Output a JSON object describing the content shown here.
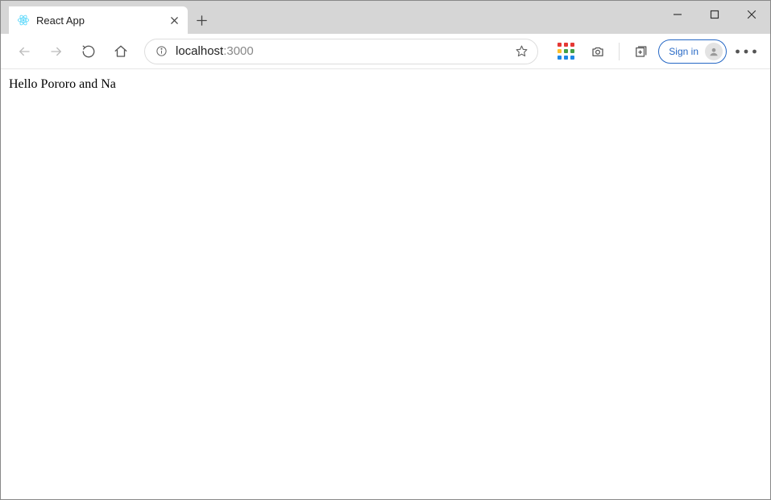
{
  "window": {
    "tab_title": "React App",
    "signin_label": "Sign in"
  },
  "address_bar": {
    "host": "localhost",
    "port": ":3000"
  },
  "page": {
    "body_text": "Hello Pororo and Na"
  }
}
